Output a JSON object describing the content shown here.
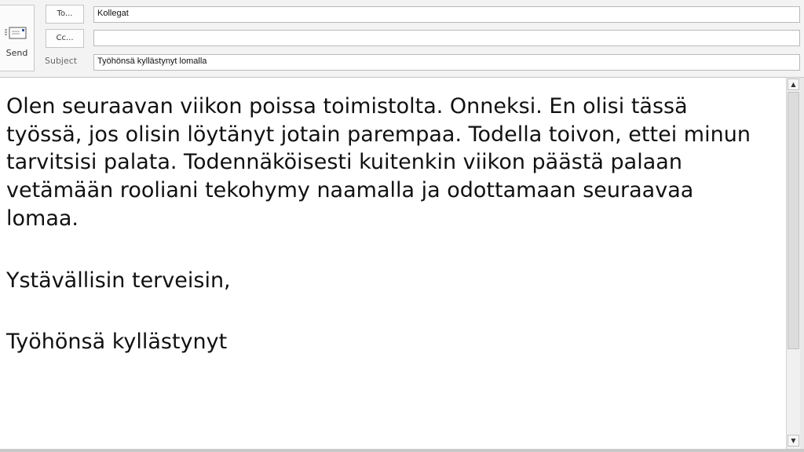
{
  "compose": {
    "send_label": "Send",
    "to_button_label": "To...",
    "cc_button_label": "Cc...",
    "subject_label": "Subject",
    "to_value": "Kollegat",
    "cc_value": "",
    "subject_value": "Työhönsä kyllästynyt lomalla"
  },
  "body": {
    "paragraph1": "Olen seuraavan viikon poissa toimistolta. Onneksi. En olisi tässä työssä, jos olisin löytänyt jotain parempaa. Todella toivon, ettei minun tarvitsisi palata. Todennäköisesti kuitenkin viikon päästä palaan vetämään rooliani tekohymy naamalla ja odottamaan seuraavaa lomaa.",
    "greeting": "Ystävällisin terveisin,",
    "signature": "Työhönsä kyllästynyt"
  },
  "scrollbar": {
    "up_arrow": "▲",
    "down_arrow": "▼"
  }
}
